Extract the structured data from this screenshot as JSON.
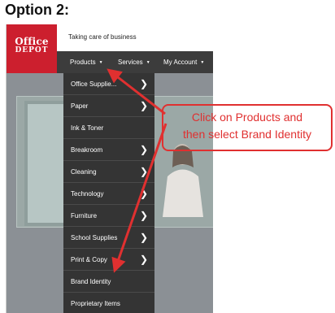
{
  "heading": "Option 2:",
  "brand": {
    "logo_line1": "Office",
    "logo_line2": "DEPOT",
    "logo_color": "#cc1f2e",
    "tagline": "Taking care of business"
  },
  "nav": {
    "products": "Products",
    "services": "Services",
    "account": "My Account"
  },
  "menu": [
    {
      "label": "Office Supplie...",
      "submenu": true
    },
    {
      "label": "Paper",
      "submenu": true
    },
    {
      "label": "Ink & Toner",
      "submenu": false
    },
    {
      "label": "Breakroom",
      "submenu": true
    },
    {
      "label": "Cleaning",
      "submenu": true
    },
    {
      "label": "Technology",
      "submenu": true
    },
    {
      "label": "Furniture",
      "submenu": true
    },
    {
      "label": "School Supplies",
      "submenu": true
    },
    {
      "label": "Print & Copy",
      "submenu": true
    },
    {
      "label": "Brand Identity",
      "submenu": false
    },
    {
      "label": "Proprietary Items",
      "submenu": false
    }
  ],
  "annotation": {
    "line1": "Click on Products and",
    "line2": "then select Brand Identity",
    "color": "#e03030"
  }
}
